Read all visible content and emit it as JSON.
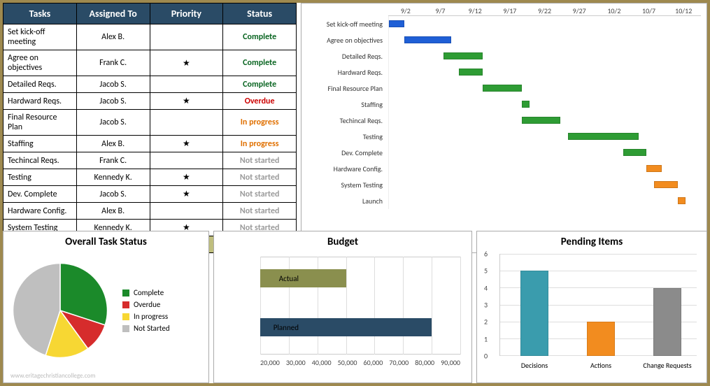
{
  "task_table": {
    "headers": [
      "Tasks",
      "Assigned To",
      "Priority",
      "Status"
    ],
    "rows": [
      {
        "task": "Set kick-off meeting",
        "assigned": "Alex B.",
        "priority": false,
        "status": "Complete"
      },
      {
        "task": "Agree on objectives",
        "assigned": "Frank C.",
        "priority": true,
        "status": "Complete"
      },
      {
        "task": "Detailed Reqs.",
        "assigned": "Jacob S.",
        "priority": false,
        "status": "Complete"
      },
      {
        "task": "Hardward Reqs.",
        "assigned": "Jacob S.",
        "priority": true,
        "status": "Overdue"
      },
      {
        "task": "Final Resource Plan",
        "assigned": "Jacob S.",
        "priority": false,
        "status": "In progress"
      },
      {
        "task": "Staffing",
        "assigned": "Alex B.",
        "priority": true,
        "status": "In progress"
      },
      {
        "task": "Techincal Reqs.",
        "assigned": "Frank C.",
        "priority": false,
        "status": "Not started"
      },
      {
        "task": "Testing",
        "assigned": "Kennedy K.",
        "priority": true,
        "status": "Not started"
      },
      {
        "task": "Dev. Complete",
        "assigned": "Jacob S.",
        "priority": true,
        "status": "Not started"
      },
      {
        "task": "Hardware Config.",
        "assigned": "Alex B.",
        "priority": false,
        "status": "Not started"
      },
      {
        "task": "System Testing",
        "assigned": "Kennedy K.",
        "priority": true,
        "status": "Not started"
      }
    ],
    "launch_label": "Launch",
    "star": "★"
  },
  "status_colors": {
    "Complete": "#0b6623",
    "Overdue": "#c00",
    "In progress": "#e07000",
    "Not started": "#9a9a9a"
  },
  "gantt": {
    "date_ticks": [
      "9/2",
      "9/7",
      "9/12",
      "9/17",
      "9/22",
      "9/27",
      "10/2",
      "10/7",
      "10/12"
    ],
    "x_min": 0,
    "x_max": 40,
    "rows": [
      {
        "label": "Set kick-off meeting",
        "start": 0,
        "len": 2,
        "color": "blue"
      },
      {
        "label": "Agree on objectives",
        "start": 2,
        "len": 6,
        "color": "blue"
      },
      {
        "label": "Detailed Reqs.",
        "start": 7,
        "len": 5,
        "color": "green"
      },
      {
        "label": "Hardward Reqs.",
        "start": 9,
        "len": 3,
        "color": "green"
      },
      {
        "label": "Final Resource Plan",
        "start": 12,
        "len": 5,
        "color": "green"
      },
      {
        "label": "Staffing",
        "start": 17,
        "len": 1,
        "color": "green"
      },
      {
        "label": "Techincal Reqs.",
        "start": 17,
        "len": 5,
        "color": "green"
      },
      {
        "label": "Testing",
        "start": 23,
        "len": 9,
        "color": "green"
      },
      {
        "label": "Dev. Complete",
        "start": 30,
        "len": 3,
        "color": "green"
      },
      {
        "label": "Hardware Config.",
        "start": 33,
        "len": 2,
        "color": "orange"
      },
      {
        "label": "System Testing",
        "start": 34,
        "len": 3,
        "color": "orange"
      },
      {
        "label": "Launch",
        "start": 37,
        "len": 1,
        "color": "orange"
      }
    ]
  },
  "chart_data": [
    {
      "type": "gantt",
      "title": "",
      "date_axis": [
        "9/2",
        "9/7",
        "9/12",
        "9/17",
        "9/22",
        "9/27",
        "10/2",
        "10/7",
        "10/12"
      ],
      "tasks": [
        {
          "name": "Set kick-off meeting",
          "start": "9/2",
          "end": "9/4",
          "group": "completed"
        },
        {
          "name": "Agree on objectives",
          "start": "9/4",
          "end": "9/10",
          "group": "completed"
        },
        {
          "name": "Detailed Reqs.",
          "start": "9/9",
          "end": "9/14",
          "group": "active"
        },
        {
          "name": "Hardward Reqs.",
          "start": "9/11",
          "end": "9/14",
          "group": "active"
        },
        {
          "name": "Final Resource Plan",
          "start": "9/14",
          "end": "9/19",
          "group": "active"
        },
        {
          "name": "Staffing",
          "start": "9/19",
          "end": "9/20",
          "group": "active"
        },
        {
          "name": "Techincal Reqs.",
          "start": "9/19",
          "end": "9/24",
          "group": "active"
        },
        {
          "name": "Testing",
          "start": "9/25",
          "end": "10/4",
          "group": "active"
        },
        {
          "name": "Dev. Complete",
          "start": "10/2",
          "end": "10/5",
          "group": "active"
        },
        {
          "name": "Hardware Config.",
          "start": "10/5",
          "end": "10/7",
          "group": "future"
        },
        {
          "name": "System Testing",
          "start": "10/6",
          "end": "10/9",
          "group": "future"
        },
        {
          "name": "Launch",
          "start": "10/9",
          "end": "10/10",
          "group": "future"
        }
      ]
    },
    {
      "type": "pie",
      "title": "Overall Task Status",
      "series": [
        {
          "name": "Complete",
          "value": 30,
          "color": "#1b8a2a"
        },
        {
          "name": "Overdue",
          "value": 10,
          "color": "#d62c2c"
        },
        {
          "name": "In progress",
          "value": 15,
          "color": "#f7d733"
        },
        {
          "name": "Not Started",
          "value": 45,
          "color": "#bfbfbf"
        }
      ]
    },
    {
      "type": "bar",
      "orientation": "horizontal",
      "title": "Budget",
      "categories": [
        "Actual",
        "Planned"
      ],
      "values": [
        50000,
        80000
      ],
      "colors": [
        "#8a8f4e",
        "#2a4b66"
      ],
      "xlim": [
        20000,
        90000
      ],
      "xticks": [
        20000,
        30000,
        40000,
        50000,
        60000,
        70000,
        80000,
        90000
      ]
    },
    {
      "type": "bar",
      "title": "Pending Items",
      "categories": [
        "Decisions",
        "Actions",
        "Change Requests"
      ],
      "values": [
        5,
        2,
        4
      ],
      "colors": [
        "#3a9cad",
        "#f28c1f",
        "#8b8b8b"
      ],
      "ylim": [
        0,
        6
      ],
      "yticks": [
        0,
        1,
        2,
        3,
        4,
        5,
        6
      ]
    }
  ],
  "panels": {
    "pie_title": "Overall Task Status",
    "budget_title": "Budget",
    "pending_title": "Pending Items"
  },
  "watermark": "www.eritagechristiancollege.com"
}
